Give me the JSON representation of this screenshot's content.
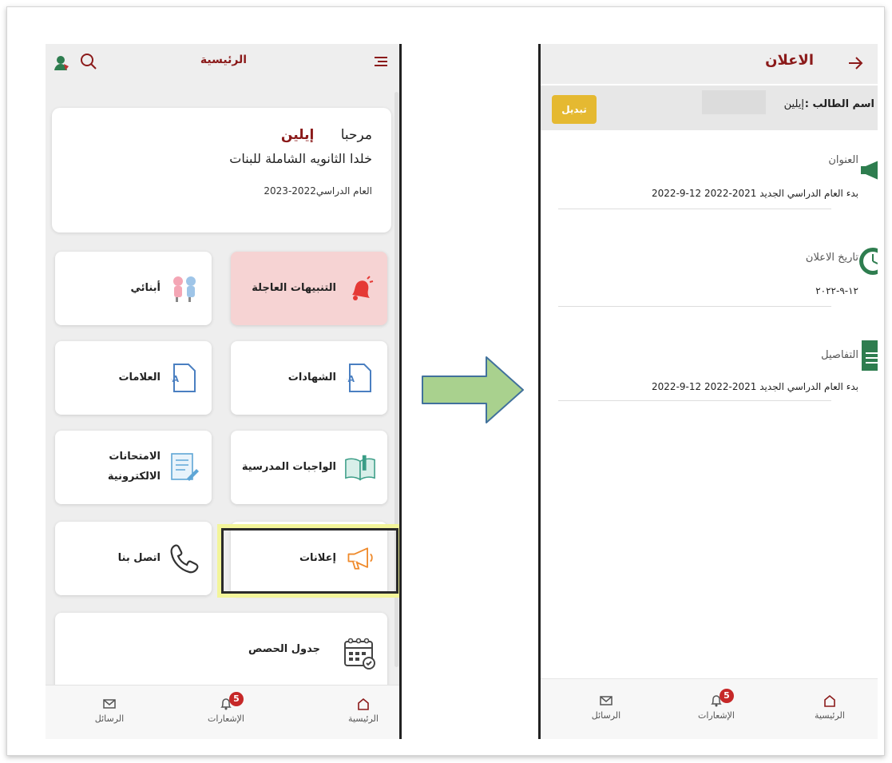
{
  "left_screen": {
    "title": "الرئيسية",
    "welcome": {
      "greeting": "مرحبا",
      "student_name": "إيلين",
      "school": "خلدا الثانويه الشاملة للبنات",
      "academic_year": "العام الدراسي2022-2023"
    },
    "tiles": {
      "urgent_alerts": "التنبيهات العاجلة",
      "my_children": "أبنائي",
      "certificates": "الشهادات",
      "grades": "العلامات",
      "homework": "الواجبات المدرسية",
      "exams_line1": "الامتحانات",
      "exams_line2": "الالكترونية",
      "announcements": "إعلانات",
      "contact_us": "اتصل بنا",
      "schedule": "جدول الحصص"
    },
    "nav": {
      "home": "الرئيسية",
      "notifications": "الإشعارات",
      "notifications_badge": "5",
      "messages": "الرسائل"
    }
  },
  "right_screen": {
    "title": "الاعلان",
    "student_label": "اسم الطالب :",
    "student_name": "إيلين",
    "switch_button": "تبديل",
    "title_label": "العنوان",
    "title_value": "بدء العام الدراسي الجديد 2021-2022 12-9-2022",
    "date_label": "تاريخ الاعلان",
    "date_value": "١٢-٩-٢٠٢٢",
    "details_label": "التفاصيل",
    "details_value": "بدء العام الدراسي الجديد 2021-2022 12-9-2022",
    "nav": {
      "home": "الرئيسية",
      "notifications": "الإشعارات",
      "notifications_badge": "5",
      "messages": "الرسائل"
    }
  },
  "colors": {
    "brand_red": "#8b1a1a",
    "alert_tile": "#f6d3d3",
    "switch_button": "#e5b931",
    "arrow_fill": "#a9d18e",
    "icon_green": "#2e7d4f"
  }
}
